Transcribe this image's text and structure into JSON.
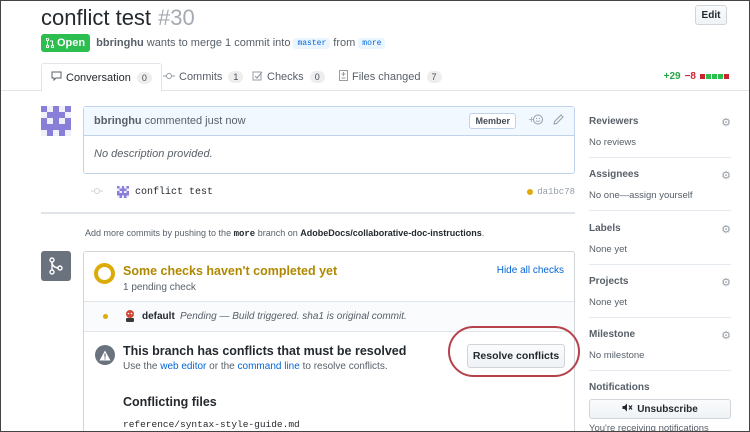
{
  "header": {
    "title": "conflict test",
    "number": "#30",
    "edit_label": "Edit"
  },
  "meta": {
    "state": "Open",
    "author": "bbringhu",
    "text_before": "wants to merge 1 commit into",
    "base_branch": "master",
    "text_from": "from",
    "head_branch": "more"
  },
  "tabs": [
    {
      "label": "Conversation",
      "count": "0"
    },
    {
      "label": "Commits",
      "count": "1"
    },
    {
      "label": "Checks",
      "count": "0"
    },
    {
      "label": "Files changed",
      "count": "7"
    }
  ],
  "diffstat": {
    "additions": "+29",
    "deletions": "−8"
  },
  "comment": {
    "author": "bbringhu",
    "action": "commented just now",
    "role": "Member",
    "body": "No description provided."
  },
  "commit": {
    "message": "conflict test",
    "sha": "da1bc78"
  },
  "push_note": {
    "before": "Add more commits by pushing to the",
    "branch": "more",
    "middle": "branch on",
    "repo": "AdobeDocs/collaborative-doc-instructions",
    "after": "."
  },
  "checks": {
    "title": "Some checks haven't completed yet",
    "subtitle": "1 pending check",
    "hide_label": "Hide all checks",
    "context": "default",
    "description": "Pending — Build triggered. sha1 is original commit."
  },
  "conflict": {
    "title": "This branch has conflicts that must be resolved",
    "desc_before": "Use the",
    "link_web": "web editor",
    "desc_or": "or the",
    "link_cli": "command line",
    "desc_after": "to resolve conflicts.",
    "resolve_label": "Resolve conflicts",
    "files_heading": "Conflicting files",
    "file": "reference/syntax-style-guide.md"
  },
  "sidebar": {
    "reviewers": {
      "title": "Reviewers",
      "value": "No reviews"
    },
    "assignees": {
      "title": "Assignees",
      "value": "No one—assign yourself"
    },
    "labels": {
      "title": "Labels",
      "value": "None yet"
    },
    "projects": {
      "title": "Projects",
      "value": "None yet"
    },
    "milestone": {
      "title": "Milestone",
      "value": "No milestone"
    },
    "notifications": {
      "title": "Notifications",
      "unsubscribe_label": "Unsubscribe",
      "receiving": "You're receiving notifications"
    }
  },
  "colors": {
    "open_green": "#2cbe4e",
    "link_blue": "#0366d6",
    "pending_yellow": "#dbab09",
    "highlight_red": "#b5414b"
  }
}
